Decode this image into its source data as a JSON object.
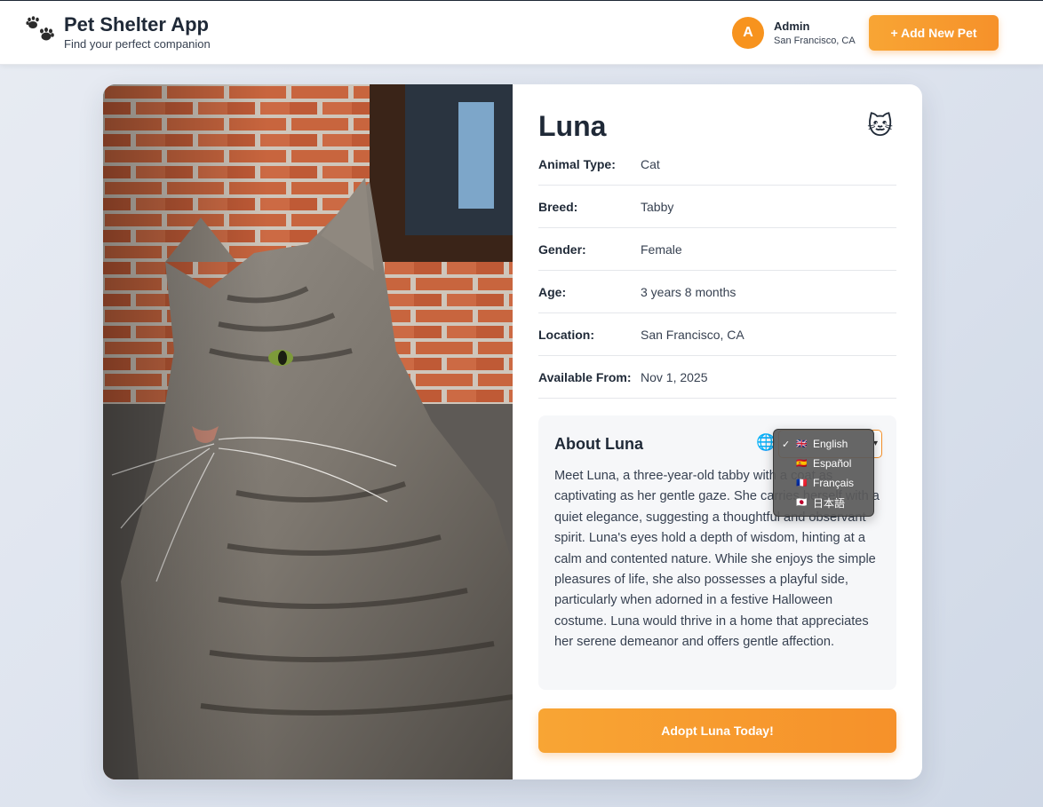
{
  "app": {
    "title": "Pet Shelter App",
    "subtitle": "Find your perfect companion",
    "logo_icon": "paw-prints-icon"
  },
  "user": {
    "initial": "A",
    "name": "Admin",
    "location": "San Francisco, CA"
  },
  "header": {
    "add_button_label": "+ Add New Pet"
  },
  "pet": {
    "name": "Luna",
    "emoji": "🐱",
    "photo_icon": "cat-photo",
    "fields": [
      {
        "label": "Animal Type:",
        "value": "Cat"
      },
      {
        "label": "Breed:",
        "value": "Tabby"
      },
      {
        "label": "Gender:",
        "value": "Female"
      },
      {
        "label": "Age:",
        "value": "3 years 8 months"
      },
      {
        "label": "Location:",
        "value": "San Francisco, CA"
      },
      {
        "label": "Available From:",
        "value": "Nov 1, 2025"
      }
    ]
  },
  "about": {
    "title": "About Luna",
    "globe_icon": "🌐",
    "text": "Meet Luna, a three-year-old tabby with a coat as captivating as her gentle gaze. She carries herself with a quiet elegance, suggesting a thoughtful and observant spirit. Luna's eyes hold a depth of wisdom, hinting at a calm and contented nature. While she enjoys the simple pleasures of life, she also possesses a playful side, particularly when adorned in a festive Halloween costume. Luna would thrive in a home that appreciates her serene demeanor and offers gentle affection."
  },
  "language_menu": {
    "selected": "English",
    "options": [
      {
        "flag": "🇬🇧",
        "label": "English",
        "checked": "✓"
      },
      {
        "flag": "🇪🇸",
        "label": "Español",
        "checked": ""
      },
      {
        "flag": "🇫🇷",
        "label": "Français",
        "checked": ""
      },
      {
        "flag": "🇯🇵",
        "label": "日本語",
        "checked": ""
      }
    ]
  },
  "adopt_button_label": "Adopt Luna Today!",
  "colors": {
    "accent": "#f6912a",
    "text": "#1f2937"
  }
}
